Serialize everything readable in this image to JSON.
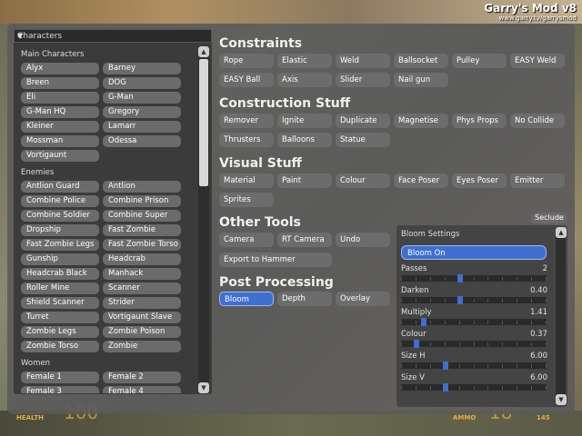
{
  "game": {
    "title": "Garry's Mod v8",
    "url": "www.garry.tv/garrysmod",
    "hud_health": "HEALTH",
    "hud_health_val": "100",
    "hud_ammo": "AMMO",
    "hud_ammo_val": "18",
    "hud_ammo2": "145"
  },
  "left": {
    "dropdown": "Characters",
    "sections": [
      {
        "label": "Main Characters",
        "items": [
          "Alyx",
          "Barney",
          "Breen",
          "DOG",
          "Eli",
          "G-Man",
          "G-Man HQ",
          "Gregory",
          "Kleiner",
          "Lamarr",
          "Mossman",
          "Odessa",
          "Vortigaunt"
        ]
      },
      {
        "label": "Enemies",
        "items": [
          "Antlion Guard",
          "Antlion",
          "Combine Police",
          "Combine Prison",
          "Combine Soldier",
          "Combine Super",
          "Dropship",
          "Fast Zombie",
          "Fast Zombie Legs",
          "Fast Zombie Torso",
          "Gunship",
          "Headcrab",
          "Headcrab Black",
          "Manhack",
          "Roller Mine",
          "Scanner",
          "Shield Scanner",
          "Strider",
          "Turret",
          "Vortigaunt Slave",
          "Zombie Legs",
          "Zombie Poison",
          "Zombie Torso",
          "Zombie"
        ]
      },
      {
        "label": "Women",
        "items": [
          "Female 1",
          "Female 2",
          "Female 3",
          "Female 4"
        ]
      }
    ]
  },
  "constraints": {
    "title": "Constraints",
    "items": [
      "Rope",
      "Elastic",
      "Weld",
      "Ballsocket",
      "Pulley",
      "EASY Weld",
      "EASY Ball",
      "Axis",
      "Slider",
      "Nail gun"
    ]
  },
  "construction": {
    "title": "Construction Stuff",
    "items": [
      "Remover",
      "Ignite",
      "Duplicate",
      "Magnetise",
      "Phys Props",
      "No Collide",
      "Thrusters",
      "Balloons",
      "Statue"
    ]
  },
  "visual": {
    "title": "Visual Stuff",
    "items": [
      "Material",
      "Paint",
      "Colour",
      "Face Poser",
      "Eyes Poser",
      "Emitter",
      "Sprites"
    ]
  },
  "other": {
    "title": "Other Tools",
    "items": [
      "Camera",
      "RT Camera",
      "Undo"
    ],
    "export": "Export to Hammer"
  },
  "post": {
    "title": "Post Processing",
    "items": [
      "Bloom",
      "Depth",
      "Overlay"
    ],
    "active": "Bloom"
  },
  "bloom": {
    "seclude": "Seclude",
    "title": "Bloom Settings",
    "toggle": "Bloom On",
    "sliders": [
      {
        "label": "Passes",
        "value": "2",
        "level": 0.4
      },
      {
        "label": "Darken",
        "value": "0.40",
        "level": 0.4
      },
      {
        "label": "Multiply",
        "value": "1.41",
        "level": 0.14
      },
      {
        "label": "Colour",
        "value": "0.37",
        "level": 0.09
      },
      {
        "label": "Size H",
        "value": "6.00",
        "level": 0.3
      },
      {
        "label": "Size V",
        "value": "6.00",
        "level": 0.3
      }
    ]
  }
}
